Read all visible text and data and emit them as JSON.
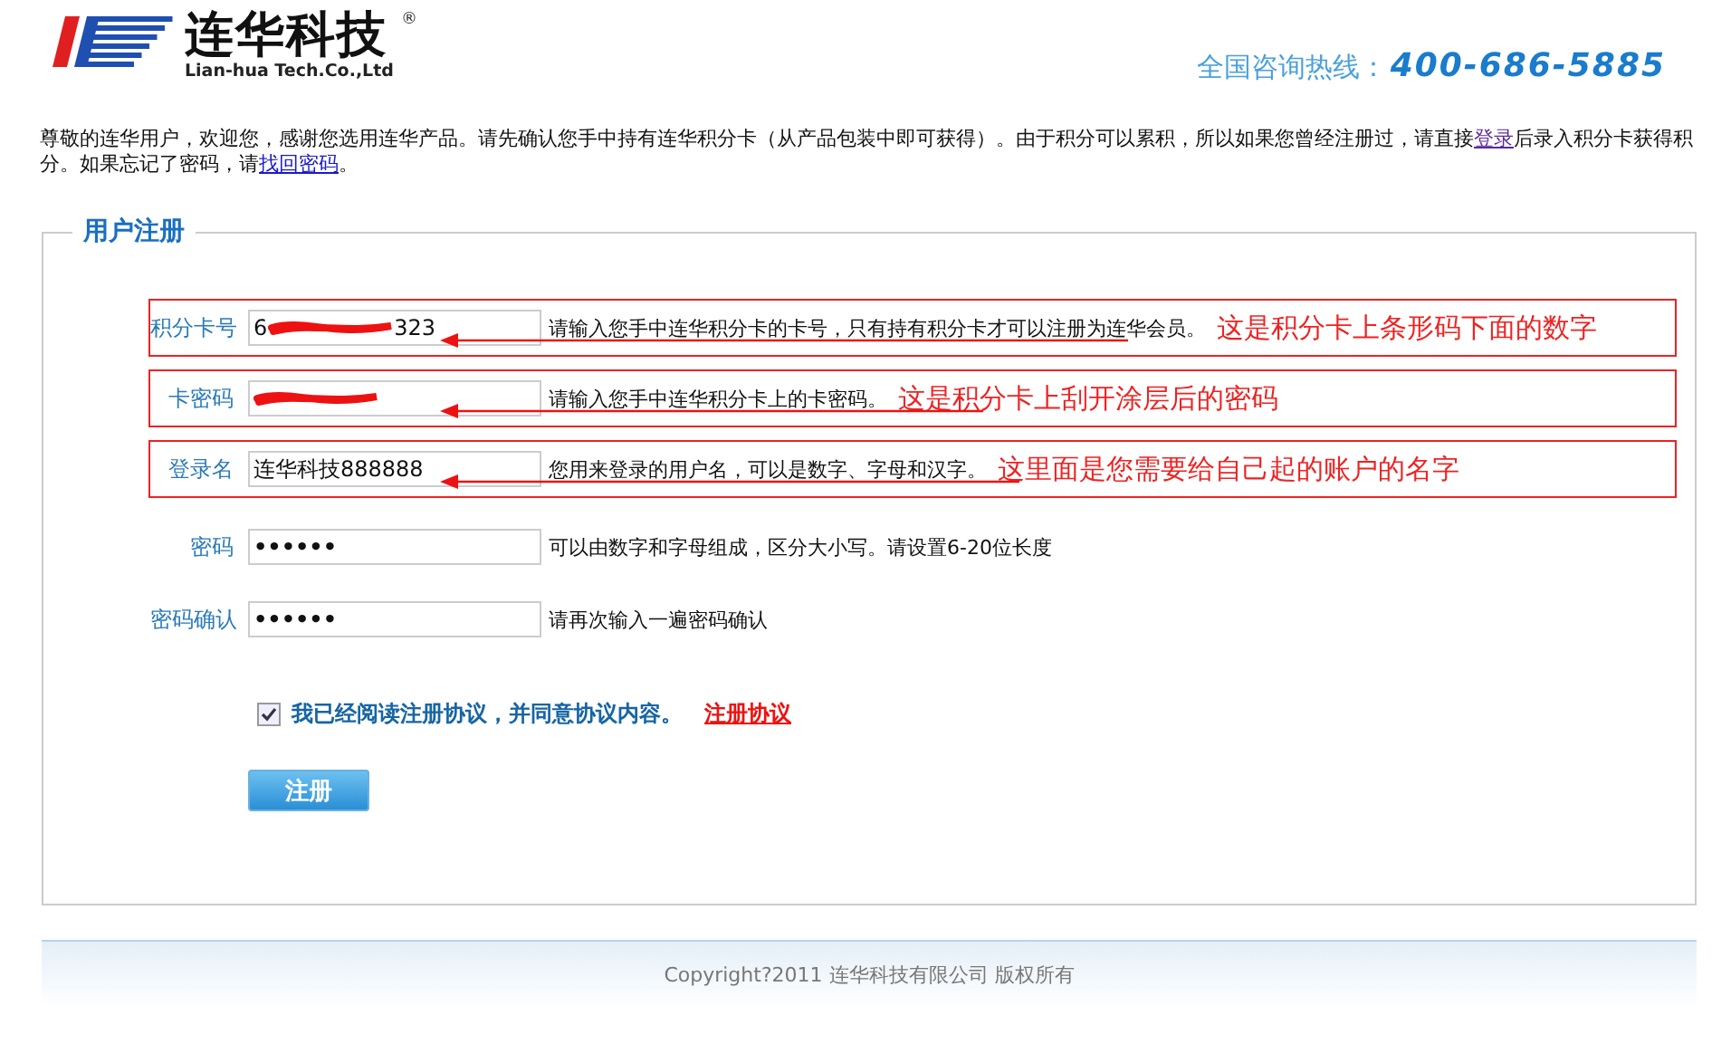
{
  "header": {
    "logo": {
      "name": "连华科技",
      "registered": "®",
      "subtitle": "Lian-hua Tech.Co.,Ltd"
    },
    "hotline": {
      "label": "全国咨询热线：",
      "number": "400-686-5885"
    }
  },
  "intro": {
    "before_login": "尊敬的连华用户，欢迎您，感谢您选用连华产品。请先确认您手中持有连华积分卡（从产品包装中即可获得）。由于积分可以累积，所以如果您曾经注册过，请直接",
    "login_link": "登录",
    "middle": "后录入积分卡获得积分。如果忘记了密码，请",
    "recover_link": "找回密码",
    "end": "。"
  },
  "form": {
    "legend": "用户注册",
    "fields": [
      {
        "label": "积分卡号",
        "kind": "text",
        "value_start": "6",
        "value_end": "323",
        "redacted": true,
        "hint": "请输入您手中连华积分卡的卡号，只有持有积分卡才可以注册为连华会员。",
        "annotation": "这是积分卡上条形码下面的数字"
      },
      {
        "label": "卡密码",
        "kind": "text",
        "redacted": true,
        "hint": "请输入您手中连华积分卡上的卡密码。",
        "annotation": "这是积分卡上刮开涂层后的密码"
      },
      {
        "label": "登录名",
        "kind": "text",
        "value_start": "连华科技888888",
        "hint": "您用来登录的用户名，可以是数字、字母和汉字。",
        "annotation": "这里面是您需要给自己起的账户的名字"
      },
      {
        "label": "密码",
        "kind": "password",
        "value_start": "••••••",
        "hint": "可以由数字和字母组成，区分大小写。请设置6-20位长度"
      },
      {
        "label": "密码确认",
        "kind": "password",
        "value_start": "••••••",
        "hint": "请再次输入一遍密码确认"
      }
    ],
    "agreement": {
      "checked": true,
      "text": "我已经阅读注册协议，并同意协议内容。",
      "link": "注册协议"
    },
    "submit": "注册"
  },
  "footer": {
    "copyright": "Copyright?2011 连华科技有限公司 版权所有"
  }
}
